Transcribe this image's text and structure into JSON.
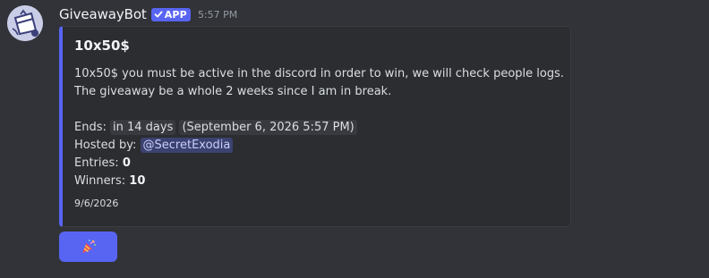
{
  "message": {
    "username": "GiveawayBot",
    "badge": "APP",
    "timestamp": "5:57 PM"
  },
  "embed": {
    "title": "10x50$",
    "description_line1": "10x50$ you must be active in the discord in order to win, we will check people logs.",
    "description_line2": "The giveaway be a whole 2 weeks since I am in break.",
    "ends_label": "Ends:",
    "ends_relative": "in 14 days",
    "ends_absolute": "(September 6, 2026 5:57 PM)",
    "hosted_label": "Hosted by:",
    "host_mention": "@SecretExodia",
    "entries_label": "Entries:",
    "entries_value": "0",
    "winners_label": "Winners:",
    "winners_value": "10",
    "footer": "9/6/2026",
    "accent_color": "#5865f2"
  },
  "button": {
    "icon": "party-popper-icon"
  },
  "colors": {
    "background": "#313338",
    "embed_background": "#2b2d31",
    "blurple": "#5865f2",
    "text": "#dbdee1",
    "muted": "#949ba4"
  }
}
